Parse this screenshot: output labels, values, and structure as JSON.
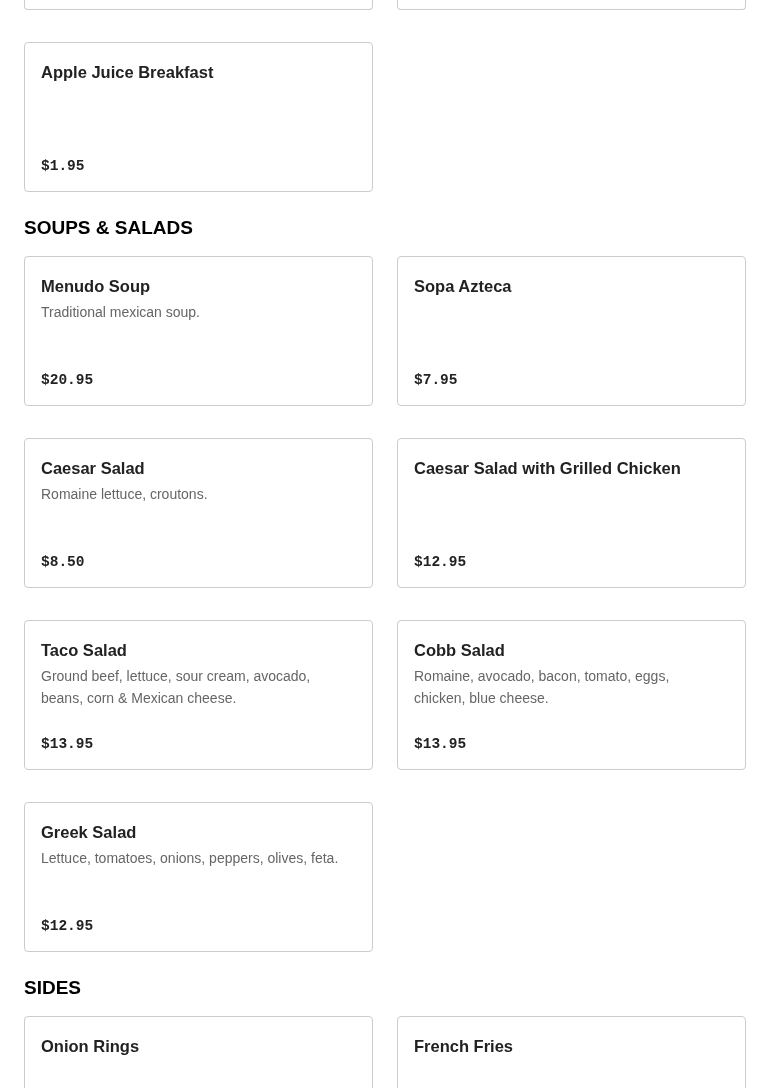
{
  "sections": [
    {
      "items": [
        {
          "name": "Apple Juice Breakfast",
          "price": "$1.95"
        }
      ]
    },
    {
      "title": "SOUPS & SALADS",
      "items": [
        {
          "name": "Menudo Soup",
          "description": "Traditional mexican soup.",
          "price": "$20.95"
        },
        {
          "name": "Sopa Azteca",
          "price": "$7.95"
        },
        {
          "name": "Caesar Salad",
          "description": "Romaine lettuce, croutons.",
          "price": "$8.50"
        },
        {
          "name": "Caesar Salad with Grilled Chicken",
          "price": "$12.95"
        },
        {
          "name": "Taco Salad",
          "description": "Ground beef, lettuce, sour cream, avocado, beans, corn & Mexican cheese.",
          "price": "$13.95"
        },
        {
          "name": "Cobb Salad",
          "description": "Romaine, avocado, bacon, tomato, eggs, chicken, blue cheese.",
          "price": "$13.95"
        },
        {
          "name": "Greek Salad",
          "description": "Lettuce, tomatoes, onions, peppers, olives, feta.",
          "price": "$12.95"
        }
      ]
    },
    {
      "title": "SIDES",
      "items": [
        {
          "name": "Onion Rings"
        },
        {
          "name": "French Fries"
        }
      ]
    }
  ]
}
